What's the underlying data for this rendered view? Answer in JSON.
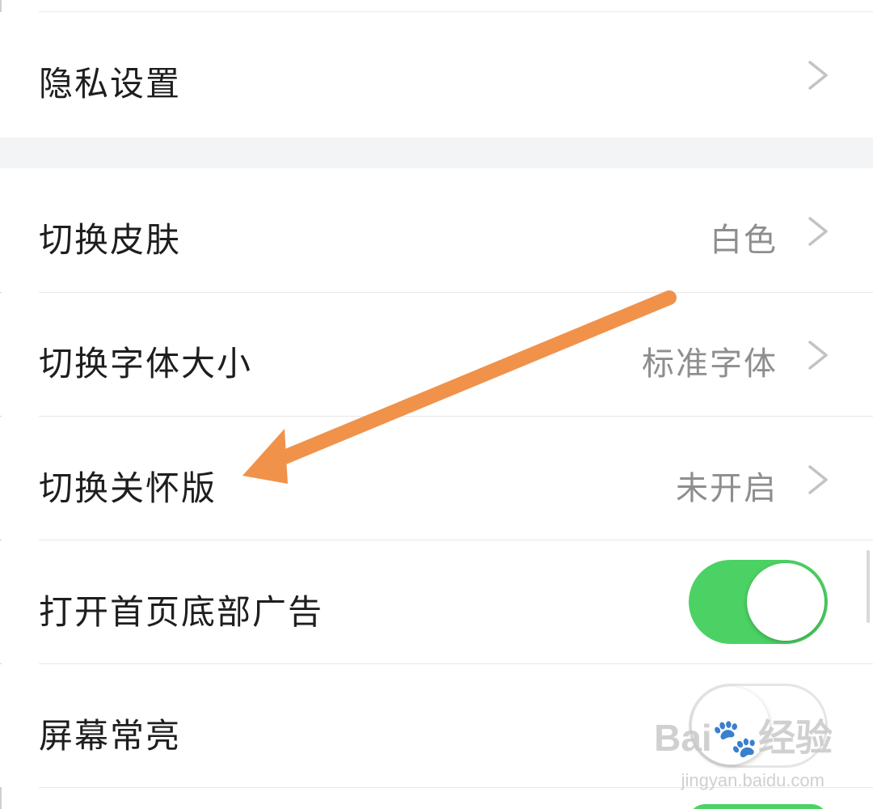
{
  "settings": {
    "privacy": {
      "label": "隐私设置"
    },
    "skin": {
      "label": "切换皮肤",
      "value": "白色"
    },
    "font_size": {
      "label": "切换字体大小",
      "value": "标准字体"
    },
    "care_mode": {
      "label": "切换关怀版",
      "value": "未开启"
    },
    "home_ad": {
      "label": "打开首页底部广告",
      "toggle_on": true
    },
    "screen_on": {
      "label": "屏幕常亮",
      "toggle_on": false
    }
  },
  "colors": {
    "toggle_on": "#4cd264",
    "annotation_arrow": "#f0924a",
    "section_gap": "#f3f4f6"
  },
  "icons": {
    "chevron": "chevron-right-icon",
    "annotation": "orange-arrow-annotation"
  },
  "watermark": {
    "brand": "Bai",
    "brand_tail": "经验",
    "url": "jingyan.baidu.com"
  }
}
